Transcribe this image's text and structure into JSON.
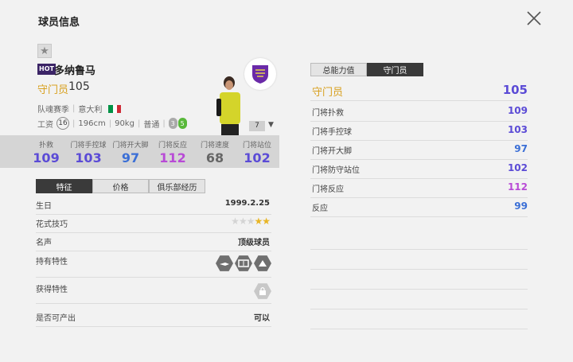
{
  "header": {
    "title": "球员信息"
  },
  "player": {
    "badge": "HOT",
    "name": "多纳鲁马",
    "position": "守门员",
    "overall": "105",
    "season": "队魂赛季",
    "nation": "意大利",
    "wage_label": "工资",
    "wage": "16",
    "height": "196cm",
    "weight": "90kg",
    "body": "普通",
    "skill_a": "3",
    "skill_b": "5",
    "level": "7"
  },
  "stats": [
    {
      "label": "扑救",
      "value": "109",
      "color": "#5b4bd6"
    },
    {
      "label": "门将手控球",
      "value": "103",
      "color": "#5b4bd6"
    },
    {
      "label": "门将开大脚",
      "value": "97",
      "color": "#3b6fd6"
    },
    {
      "label": "门将反应",
      "value": "112",
      "color": "#b84ad6"
    },
    {
      "label": "门将速度",
      "value": "68",
      "color": "#666666"
    },
    {
      "label": "门将站位",
      "value": "102",
      "color": "#5b4bd6"
    }
  ],
  "left_tabs": [
    "特征",
    "价格",
    "俱乐部经历"
  ],
  "info": {
    "birthday_label": "生日",
    "birthday": "1999.2.25",
    "skill_label": "花式技巧",
    "skill_stars": {
      "filled": 2,
      "total": 5
    },
    "fame_label": "名声",
    "fame": "顶级球员",
    "traits_label": "持有特性",
    "gained_label": "获得特性",
    "tradable_label": "是否可产出",
    "tradable": "可以"
  },
  "right_tabs": [
    "总能力值",
    "守门员"
  ],
  "ratings": {
    "header_label": "守门员",
    "header_value": "105",
    "rows": [
      {
        "label": "门将扑救",
        "value": "109",
        "color": "#5b4bd6"
      },
      {
        "label": "门将手控球",
        "value": "103",
        "color": "#5b4bd6"
      },
      {
        "label": "门将开大脚",
        "value": "97",
        "color": "#3b6fd6"
      },
      {
        "label": "门将防守站位",
        "value": "102",
        "color": "#5b4bd6"
      },
      {
        "label": "门将反应",
        "value": "112",
        "color": "#b84ad6"
      },
      {
        "label": "反应",
        "value": "99",
        "color": "#3b6fd6"
      }
    ]
  },
  "colors": {
    "gold": "#d8a01e",
    "dark_tab": "#3a3a3a",
    "hot_badge": "#3b2466"
  },
  "icons": [
    "close-icon",
    "star-icon",
    "club-crest-icon",
    "chevron-down-icon",
    "trait-icon",
    "lock-icon"
  ]
}
